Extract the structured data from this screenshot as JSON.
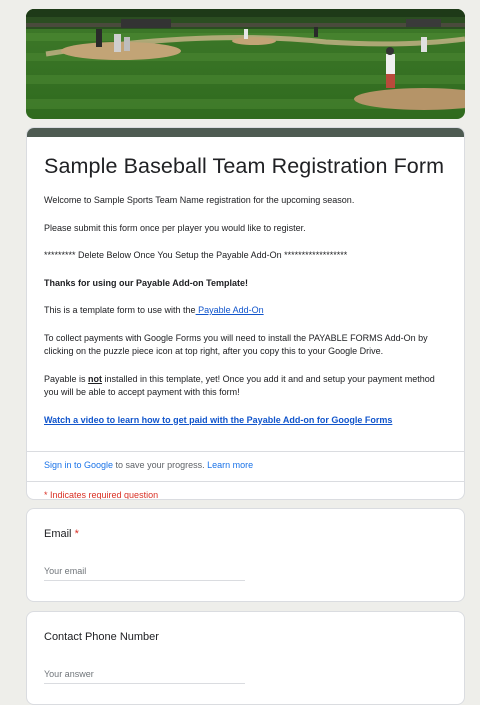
{
  "form": {
    "title": "Sample Baseball Team Registration Form",
    "intro": "Welcome to Sample Sports Team Name registration for the upcoming season.",
    "instruction": "Please submit this form once per player you would like to register.",
    "delete_note": "********* Delete Below Once You Setup the Payable Add-On ******************",
    "thanks": "Thanks for using our Payable Add-on Template!",
    "template_text": "This is a template form to use with the",
    "template_link": " Payable Add-On",
    "collect_text": "To collect payments with Google Forms you will need to install the PAYABLE FORMS Add-On by clicking on the puzzle piece icon at top right, after you copy this to your Google Drive.",
    "payable_a": "Payable is ",
    "payable_not": "not",
    "payable_b": " installed in this template, yet! Once you add it and and setup your payment method you will be able to accept payment with this form!",
    "video_link": "Watch a video to learn how to get paid with the Payable Add-on for Google Forms"
  },
  "signin": {
    "link": "Sign in to Google",
    "text": " to save your progress. ",
    "learn_more": "Learn more"
  },
  "required_note": "* Indicates required question",
  "questions": [
    {
      "label": "Email",
      "required_mark": "*",
      "placeholder": "Your email"
    },
    {
      "label": "Contact Phone Number",
      "placeholder": "Your answer"
    }
  ],
  "colors": {
    "header_bar": "#4e5b52",
    "link": "#1155cc",
    "required": "#d93025",
    "background": "#eeeeea"
  }
}
